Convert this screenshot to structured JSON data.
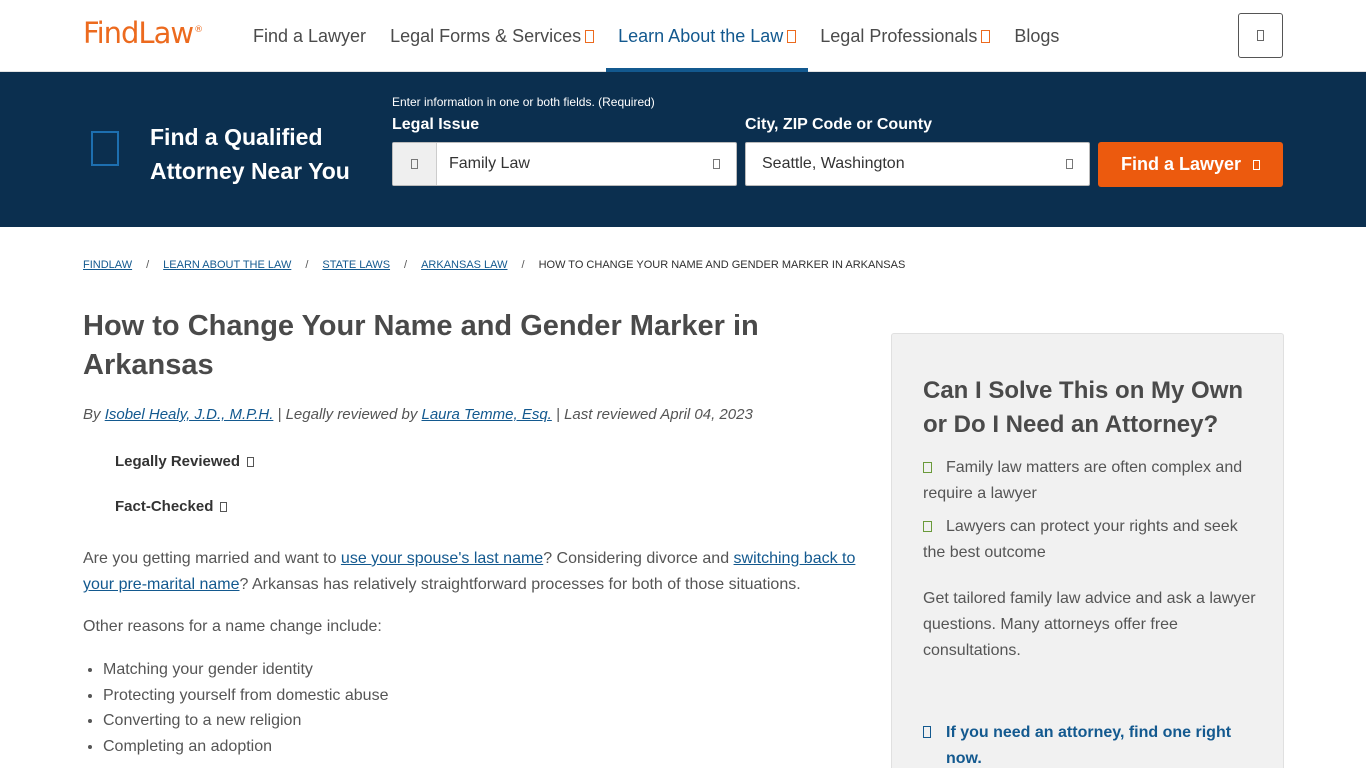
{
  "nav": {
    "logo": "FindLaw",
    "logo_mark": "®",
    "links": [
      {
        "label": "Find a Lawyer"
      },
      {
        "label": "Legal Forms & Services"
      },
      {
        "label": "Learn About the Law"
      },
      {
        "label": "Legal Professionals"
      },
      {
        "label": "Blogs"
      }
    ]
  },
  "search": {
    "heading": "Find a Qualified Attorney Near You",
    "hint": "Enter information in one or both fields. (Required)",
    "issue_label": "Legal Issue",
    "issue_value": "Family Law",
    "location_label": "City, ZIP Code or County",
    "location_value": "Seattle, Washington",
    "button": "Find a Lawyer"
  },
  "breadcrumb": [
    "FINDLAW",
    "LEARN ABOUT THE LAW",
    "STATE LAWS",
    "ARKANSAS LAW",
    "HOW TO CHANGE YOUR NAME AND GENDER MARKER IN ARKANSAS"
  ],
  "breadcrumb_sep": "/",
  "article": {
    "title": "How to Change Your Name and Gender Marker in Arkansas",
    "by": "By ",
    "author": "Isobel Healy, J.D., M.P.H.",
    "reviewed_prefix": " | Legally reviewed by ",
    "reviewer": "Laura Temme, Esq.",
    "last_reviewed": " | Last reviewed April 04, 2023",
    "badge_reviewed": "Legally Reviewed",
    "badge_checked": "Fact-Checked",
    "p1_a": "Are you getting married and want to ",
    "p1_link1": "use your spouse's last name",
    "p1_b": "? Considering divorce and ",
    "p1_link2": "switching back to your pre-marital name",
    "p1_c": "? Arkansas has relatively straightforward processes for both of those situations.",
    "p2": "Other reasons for a name change include:",
    "reasons": [
      "Matching your gender identity",
      "Protecting yourself from domestic abuse",
      "Converting to a new religion",
      "Completing an adoption"
    ]
  },
  "sidebar": {
    "title": "Can I Solve This on My Own or Do I Need an Attorney?",
    "points": [
      "Family law matters are often complex and require a lawyer",
      "Lawyers can protect your rights and seek the best outcome"
    ],
    "body": "Get tailored family law advice and ask a lawyer questions. Many attorneys offer free consultations.",
    "link": "If you need an attorney, find one right now."
  }
}
